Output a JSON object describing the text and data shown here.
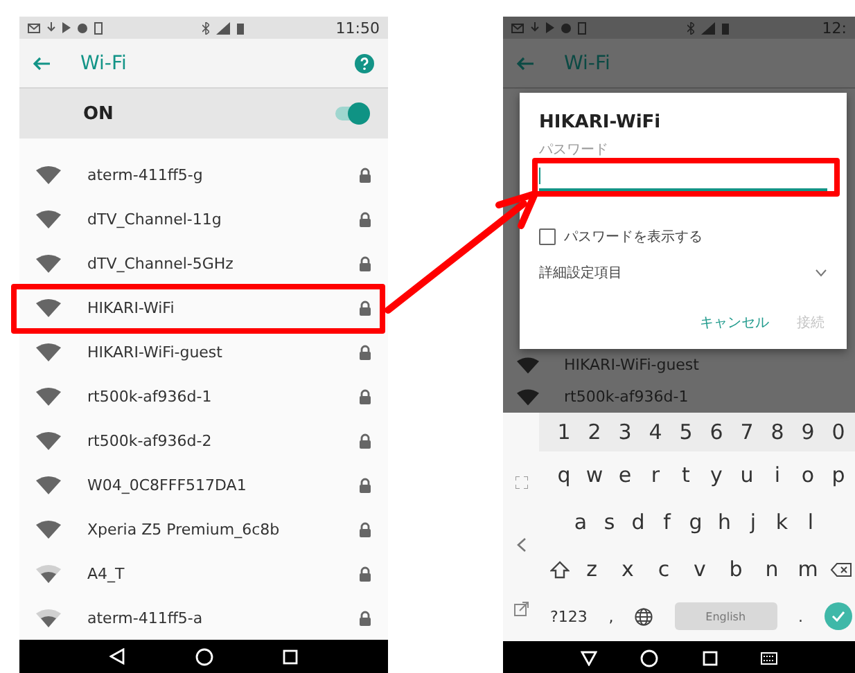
{
  "left_screen": {
    "status_bar": {
      "time": "11:50"
    },
    "app_bar": {
      "title": "Wi-Fi"
    },
    "master_switch": {
      "label": "ON",
      "on": true
    },
    "networks": [
      {
        "name": "aterm-411ff5-g",
        "kind": "full",
        "highlighted": false
      },
      {
        "name": "dTV_Channel-11g",
        "kind": "full",
        "highlighted": false
      },
      {
        "name": "dTV_Channel-5GHz",
        "kind": "full",
        "highlighted": false
      },
      {
        "name": "HIKARI-WiFi",
        "kind": "full",
        "highlighted": true
      },
      {
        "name": "HIKARI-WiFi-guest",
        "kind": "full",
        "highlighted": false
      },
      {
        "name": "rt500k-af936d-1",
        "kind": "full",
        "highlighted": false
      },
      {
        "name": "rt500k-af936d-2",
        "kind": "full",
        "highlighted": false
      },
      {
        "name": "W04_0C8FFF517DA1",
        "kind": "full",
        "highlighted": false
      },
      {
        "name": "Xperia Z5 Premium_6c8b",
        "kind": "full",
        "highlighted": false
      },
      {
        "name": "A4_T",
        "kind": "partial",
        "highlighted": false
      },
      {
        "name": "aterm-411ff5-a",
        "kind": "partial",
        "highlighted": false
      }
    ]
  },
  "right_screen": {
    "status_bar": {
      "time": "12:"
    },
    "app_bar": {
      "title": "Wi-Fi"
    },
    "dialog": {
      "title": "HIKARI-WiFi",
      "password_field": {
        "label": "パスワード",
        "highlighted": true
      },
      "show_password": {
        "label": "パスワードを表示する",
        "checked": false
      },
      "advanced": {
        "label": "詳細設定項目",
        "expanded": false
      },
      "buttons": [
        {
          "label": "キャンセル",
          "disabled": false
        },
        {
          "label": "接続",
          "disabled": true
        }
      ]
    },
    "networks_behind": [
      {
        "name": "HIKARI-WiFi-guest"
      },
      {
        "name": "rt500k-af936d-1"
      }
    ],
    "keyboard": {
      "rows": [
        {
          "kind": "numbers",
          "keys": [
            "1",
            "2",
            "3",
            "4",
            "5",
            "6",
            "7",
            "8",
            "9",
            "0"
          ]
        },
        {
          "kind": "letters",
          "keys": [
            "q",
            "w",
            "e",
            "r",
            "t",
            "y",
            "u",
            "i",
            "o",
            "p"
          ]
        },
        {
          "kind": "letters",
          "keys": [
            "a",
            "s",
            "d",
            "f",
            "g",
            "h",
            "j",
            "k",
            "l"
          ]
        },
        {
          "kind": "shift",
          "keys": [
            "z",
            "x",
            "c",
            "v",
            "b",
            "n",
            "m"
          ]
        },
        {
          "kind": "bottom",
          "keys": [
            "?123",
            ",",
            "English",
            "."
          ]
        }
      ]
    }
  }
}
